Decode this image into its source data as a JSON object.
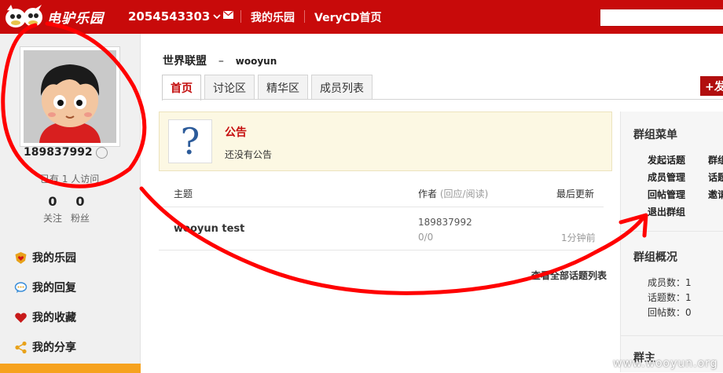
{
  "topbar": {
    "logo_text": "电驴乐园",
    "account_id": "2054543303",
    "links": [
      "我的乐园",
      "VeryCD首页"
    ],
    "search_value": ""
  },
  "sidebar": {
    "user_id": "189837992",
    "visitors_text": "已有 1 人访问",
    "following_count": "0",
    "following_label": "关注",
    "fans_count": "0",
    "fans_label": "粉丝",
    "nav": [
      {
        "label": "我的乐园",
        "icon": "heart-shield-icon"
      },
      {
        "label": "我的回复",
        "icon": "speech-bubble-icon"
      },
      {
        "label": "我的收藏",
        "icon": "heart-icon"
      },
      {
        "label": "我的分享",
        "icon": "share-icon"
      }
    ]
  },
  "group": {
    "name": "世界联盟",
    "separator": "–",
    "owner": "wooyun"
  },
  "tabs": [
    "首页",
    "讨论区",
    "精华区",
    "成员列表"
  ],
  "post_button_label": "+发",
  "notice": {
    "title": "公告",
    "text": "还没有公告"
  },
  "topics_table": {
    "headers": {
      "topic": "主题",
      "author": "作者",
      "author_sub": "(回应/阅读)",
      "updated": "最后更新"
    },
    "rows": [
      {
        "title": "wooyun test",
        "author": "189837992",
        "counts": "0/0",
        "updated": "1分钟前"
      }
    ],
    "all_link": "查看全部话题列表"
  },
  "group_menu": {
    "title": "群组菜单",
    "left_links": [
      "发起话题",
      "成员管理",
      "回帖管理",
      "退出群组"
    ],
    "right_links": [
      "群组",
      "话题",
      "邀请"
    ]
  },
  "group_overview": {
    "title": "群组概况",
    "members": "成员数：1",
    "topics": "话题数：1",
    "replies": "回帖数：0"
  },
  "owner_panel": {
    "title": "群主"
  },
  "watermark": "www.wooyun.org",
  "colors": {
    "brand_red": "#c80a0a",
    "annotation_red": "#ff0000",
    "notice_bg": "#fcf8e3"
  }
}
